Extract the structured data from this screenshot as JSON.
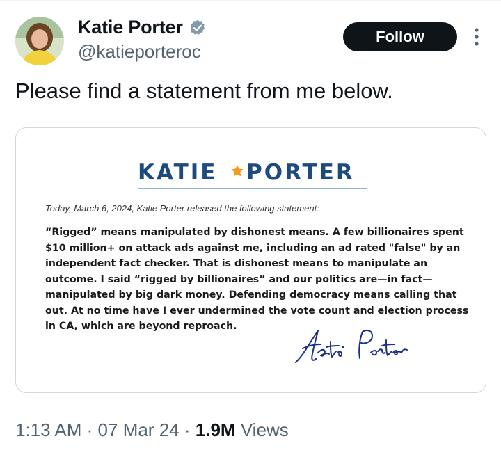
{
  "author": {
    "name": "Katie Porter",
    "handle": "@katieporteroc",
    "verified": true
  },
  "actions": {
    "follow_label": "Follow",
    "more_icon": "more-vertical-icon"
  },
  "tweet": {
    "text": "Please find a statement from me below."
  },
  "image_card": {
    "logo_left": "KATIE",
    "logo_right": "PORTER",
    "dateline": "Today, March 6, 2024, Katie Porter released the following statement:",
    "statement_lines": [
      "“Rigged” means manipulated by dishonest means. A few billionaires spent",
      "$10 million+ on attack ads against me, including an ad rated \"false\" by an",
      "independent fact checker. That is dishonest means to manipulate an",
      "outcome. I said “rigged by billionaires” and our politics are—in fact—",
      "manipulated by big dark money. Defending democracy means calling that",
      "out. At no time have I ever undermined the vote count and election process",
      "in CA, which are beyond reproach."
    ],
    "signature": "Katie Porter"
  },
  "meta": {
    "time": "1:13 AM",
    "date": "07 Mar 24",
    "views_count": "1.9M",
    "views_label": "Views",
    "separator": "·"
  },
  "colors": {
    "follow_bg": "#0f1419",
    "verified": "#829aab",
    "logo_blue": "#1e4b7d",
    "logo_star": "#f39a1f",
    "muted_text": "#536471",
    "signature_ink": "#1d2e8c"
  }
}
